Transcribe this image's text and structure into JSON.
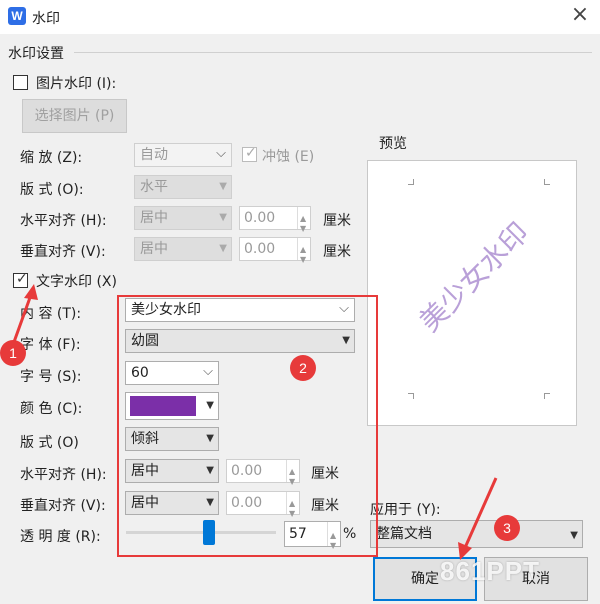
{
  "window": {
    "title": "水印",
    "app_icon": "W",
    "close": "×"
  },
  "group_title": "水印设置",
  "picture": {
    "checkbox_label": "图片水印 (I):",
    "select_button": "选择图片 (P)",
    "zoom": {
      "label": "缩  放 (Z):",
      "value": "自动"
    },
    "washout": {
      "label": "冲蚀 (E)",
      "tick": "✓"
    },
    "layout": {
      "label": "版  式 (O):",
      "value": "水平"
    },
    "h_align": {
      "label": "水平对齐 (H):",
      "value": "居中",
      "offset": "0.00",
      "unit": "厘米"
    },
    "v_align": {
      "label": "垂直对齐 (V):",
      "value": "居中",
      "offset": "0.00",
      "unit": "厘米"
    }
  },
  "text": {
    "checkbox_label": "文字水印 (X)",
    "tick": "✓",
    "content": {
      "label": "内  容 (T):",
      "value": "美少女水印"
    },
    "font": {
      "label": "字  体 (F):",
      "value": "幼圆"
    },
    "size": {
      "label": "字  号 (S):",
      "value": "60"
    },
    "color": {
      "label": "颜  色 (C):",
      "value": "#7b2fa8"
    },
    "layout": {
      "label": "版  式 (O)",
      "value": "倾斜"
    },
    "h_align": {
      "label": "水平对齐 (H):",
      "value": "居中",
      "offset": "0.00",
      "unit": "厘米"
    },
    "v_align": {
      "label": "垂直对齐 (V):",
      "value": "居中",
      "offset": "0.00",
      "unit": "厘米"
    },
    "transparency": {
      "label": "透 明 度 (R):",
      "value": "57",
      "unit": "%",
      "level": 0.57
    }
  },
  "preview": {
    "label": "预览",
    "watermark_text": "美少女水印"
  },
  "apply_to": {
    "label": "应用于 (Y):",
    "value": "整篇文档"
  },
  "buttons": {
    "ok": "确定",
    "cancel": "取消"
  },
  "annotations": {
    "badge1": "1",
    "badge2": "2",
    "badge3": "3",
    "accent": "#e73a3a"
  },
  "overlay_logo": "861PPT"
}
